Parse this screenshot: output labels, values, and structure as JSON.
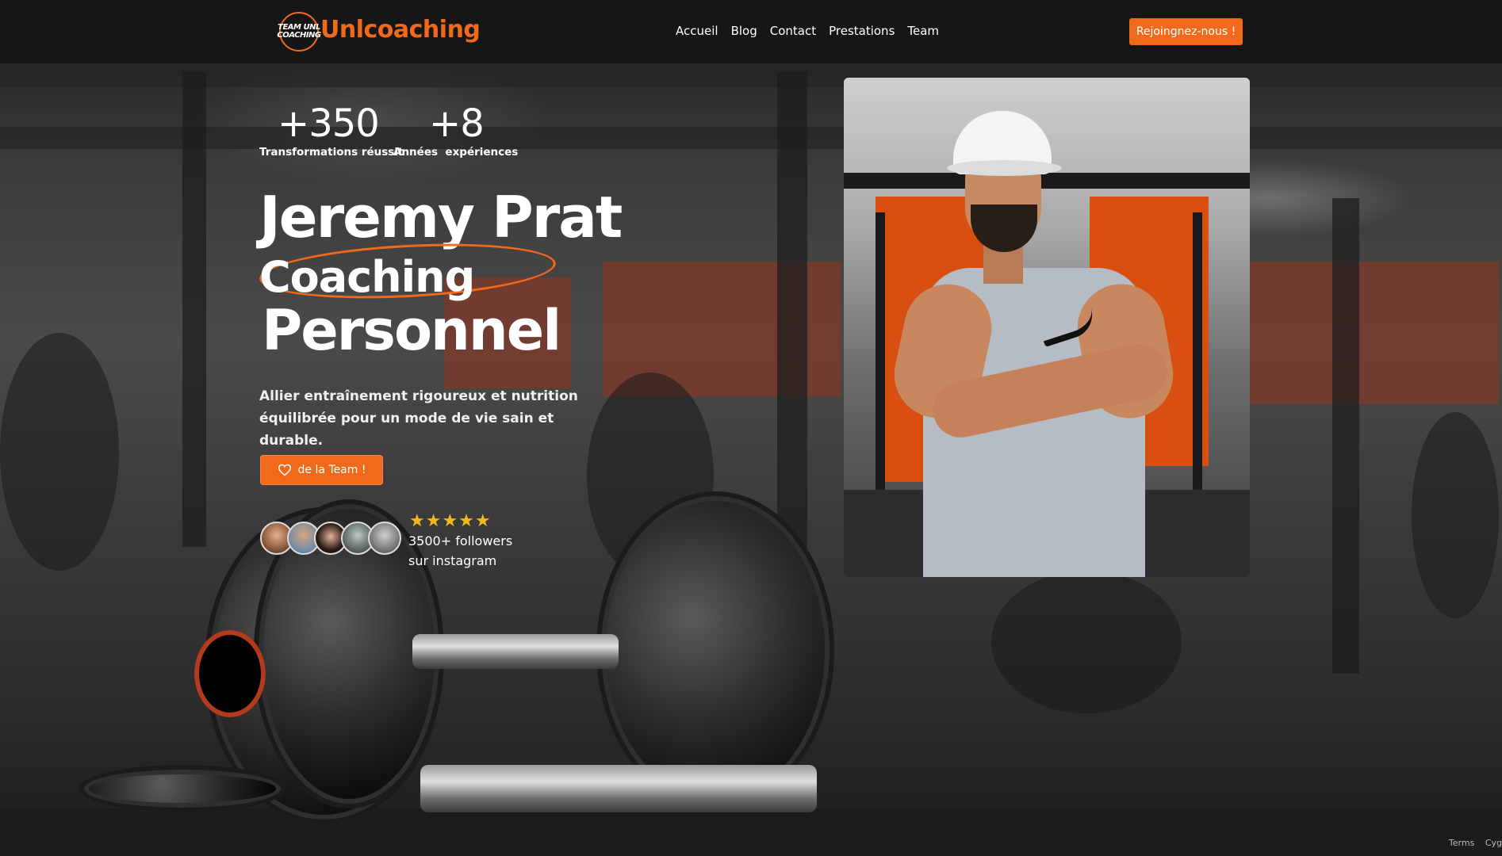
{
  "header": {
    "logo_text": "TEAM UNL COACHING",
    "brand": "Unlcoaching",
    "nav": [
      "Accueil",
      "Blog",
      "Contact",
      "Prestations",
      "Team"
    ],
    "cta": "Rejoingnez-nous !"
  },
  "stats": [
    {
      "value": "+350",
      "label": "Transformations réussit"
    },
    {
      "value": "+8",
      "label": "Années  expériences"
    }
  ],
  "hero": {
    "title_line1": "Jeremy Prat",
    "title_line2": "Coaching",
    "title_line3": "Personnel",
    "subtitle": "Allier entraînement rigoureux et nutrition équilibrée pour un mode de vie sain et durable.",
    "join_button": "de la Team !"
  },
  "social": {
    "stars": "★★★★★",
    "rating": 5,
    "followers_line1": "3500+ followers",
    "followers_line2": "sur instagram"
  },
  "footer": {
    "links": [
      "Terms",
      "Cyg"
    ]
  },
  "colors": {
    "accent": "#f16a1c",
    "star": "#f5b81b"
  },
  "icons": {
    "join_button_icon": "heart-icon"
  }
}
